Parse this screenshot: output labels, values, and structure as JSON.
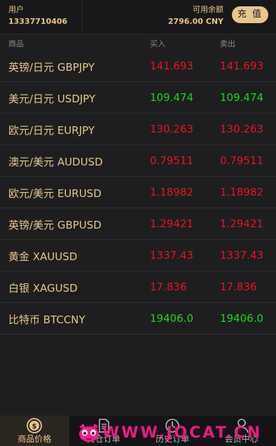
{
  "header": {
    "user_label": "用户",
    "user_id": "13337710406",
    "balance_label": "可用余额",
    "balance_value": "2796.00 CNY",
    "recharge_label": "充 值"
  },
  "columns": {
    "product": "商品",
    "buy": "买入",
    "sell": "卖出"
  },
  "quotes": [
    {
      "name": "英镑/日元 GBPJPY",
      "buy": "141.693",
      "sell": "141.693",
      "trend": "up"
    },
    {
      "name": "美元/日元 USDJPY",
      "buy": "109.474",
      "sell": "109.474",
      "trend": "down"
    },
    {
      "name": "欧元/日元 EURJPY",
      "buy": "130.263",
      "sell": "130.263",
      "trend": "up"
    },
    {
      "name": "澳元/美元 AUDUSD",
      "buy": "0.79511",
      "sell": "0.79511",
      "trend": "up"
    },
    {
      "name": "欧元/美元 EURUSD",
      "buy": "1.18982",
      "sell": "1.18982",
      "trend": "up"
    },
    {
      "name": "英镑/美元 GBPUSD",
      "buy": "1.29421",
      "sell": "1.29421",
      "trend": "up"
    },
    {
      "name": "黄金 XAUUSD",
      "buy": "1337.43",
      "sell": "1337.43",
      "trend": "up"
    },
    {
      "name": "白银 XAGUSD",
      "buy": "17.836",
      "sell": "17.836",
      "trend": "up"
    },
    {
      "name": "比特币 BTCCNY",
      "buy": "19406.0",
      "sell": "19406.0",
      "trend": "down"
    }
  ],
  "tabs": [
    {
      "label": "商品价格",
      "icon": "dollar-coin-icon",
      "active": true
    },
    {
      "label": "持仓订单",
      "icon": "document-icon",
      "active": false
    },
    {
      "label": "历史订单",
      "icon": "clock-icon",
      "active": false
    },
    {
      "label": "会员中心",
      "icon": "user-icon",
      "active": false
    }
  ],
  "watermark": {
    "text": "WWW.JQCAT.CN"
  },
  "colors": {
    "accent_gold": "#e8c58a",
    "price_up": "#e8141f",
    "price_down": "#1fd31f",
    "background": "#1e1e20",
    "watermark_pink": "#ff1a8c"
  }
}
